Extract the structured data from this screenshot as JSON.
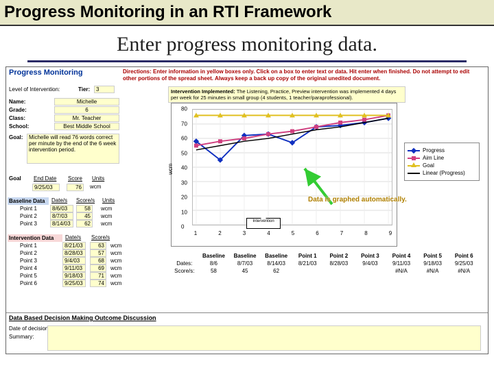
{
  "slide": {
    "title": "Progress Monitoring in an RTI Framework",
    "subtitle": "Enter progress monitoring data."
  },
  "sheet": {
    "heading": "Progress Monitoring",
    "directions": "Directions: Enter information in yellow boxes only. Click on a box to enter text or data. Hit enter when finished. Do not attempt to edit other portions of the spread sheet. Always keep a back up copy of the original unedited document.",
    "level_label": "Level of Intervention:",
    "tier_label": "Tier:",
    "tier_value": "3",
    "name_label": "Name:",
    "name_value": "Michelle",
    "grade_label": "Grade:",
    "grade_value": "6",
    "class_label": "Class:",
    "class_value": "Mr. Teacher",
    "school_label": "School:",
    "school_value": "Best Middle School",
    "goal_label": "Goal:",
    "goal_text": "Michelle will read 76 words correct per minute by the end of the 6 week intervention period.",
    "intervention_label": "Intervention Implemented:",
    "intervention_text": "The Listening, Practice, Preview intervention was implemented 4 days per week for 25 minutes in small group (4 students, 1 teacher/paraprofessional).",
    "goal_row": {
      "hdr": "Goal",
      "end_date_hdr": "End Date",
      "score_hdr": "Score",
      "units_hdr": "Units",
      "end_date": "9/25/03",
      "score": "76",
      "units": "wcm"
    },
    "baseline": {
      "hdr": "Baseline Data",
      "cols": [
        "Date/s",
        "Score/s",
        "Units"
      ],
      "rows": [
        {
          "label": "Point 1",
          "date": "8/6/03",
          "score": "58",
          "units": "wcm"
        },
        {
          "label": "Point 2",
          "date": "8/7/03",
          "score": "45",
          "units": "wcm"
        },
        {
          "label": "Point 3",
          "date": "8/14/03",
          "score": "62",
          "units": "wcm"
        }
      ]
    },
    "intervention_data": {
      "hdr": "Intervention Data",
      "cols": [
        "Date/s",
        "Score/s"
      ],
      "rows": [
        {
          "label": "Point 1",
          "date": "8/21/03",
          "score": "63",
          "units": "wcm"
        },
        {
          "label": "Point 2",
          "date": "8/28/03",
          "score": "57",
          "units": "wcm"
        },
        {
          "label": "Point 3",
          "date": "9/4/03",
          "score": "68",
          "units": "wcm"
        },
        {
          "label": "Point 4",
          "date": "9/11/03",
          "score": "69",
          "units": "wcm"
        },
        {
          "label": "Point 5",
          "date": "9/18/03",
          "score": "71",
          "units": "wcm"
        },
        {
          "label": "Point 6",
          "date": "9/25/03",
          "score": "74",
          "units": "wcm"
        }
      ]
    },
    "discussion_hdr": "Data Based Decision Making Outcome Discussion",
    "discussion_labels": {
      "date": "Date of decision:",
      "summary": "Summary:"
    },
    "bottom_table": {
      "headers": [
        "",
        "Baseline",
        "Baseline",
        "Baseline",
        "Point 1",
        "Point 2",
        "Point 3",
        "Point 4",
        "Point 5",
        "Point 6"
      ],
      "row1": [
        "Dates:",
        "8/6",
        "8/7/03",
        "8/14/03",
        "8/21/03",
        "8/28/03",
        "9/4/03",
        "9/11/03",
        "9/18/03",
        "9/25/03"
      ],
      "row2": [
        "Score/s:",
        "58",
        "45",
        "62",
        "",
        "",
        "",
        "#N/A",
        "#N/A",
        "#N/A"
      ]
    },
    "enter_box": "Intervention",
    "callout": "Data is graphed automatically."
  },
  "chart_data": {
    "type": "line",
    "ylabel": "wcm",
    "ylim": [
      0,
      80
    ],
    "yticks": [
      0,
      10,
      20,
      30,
      40,
      50,
      60,
      70,
      80
    ],
    "xticks": [
      "1",
      "2",
      "3",
      "4",
      "5",
      "6",
      "7",
      "8",
      "9"
    ],
    "series": [
      {
        "name": "Progress",
        "color": "#1030c0",
        "marker": "diamond",
        "values": [
          58,
          45,
          62,
          63,
          57,
          68,
          69,
          71,
          74
        ]
      },
      {
        "name": "Aim Line",
        "color": "#d04080",
        "marker": "square",
        "values": [
          55,
          58,
          60,
          63,
          65,
          68,
          71,
          73,
          76
        ]
      },
      {
        "name": "Goal",
        "color": "#e0c020",
        "marker": "triangle",
        "values": [
          76,
          76,
          76,
          76,
          76,
          76,
          76,
          76,
          76
        ]
      },
      {
        "name": "Linear (Progress)",
        "color": "#000",
        "marker": "none",
        "values": [
          52,
          55,
          58,
          60,
          63,
          66,
          68,
          71,
          74
        ]
      }
    ],
    "legend_labels": [
      "Progress",
      "Aim Line",
      "Goal",
      "Linear (Progress)"
    ]
  }
}
